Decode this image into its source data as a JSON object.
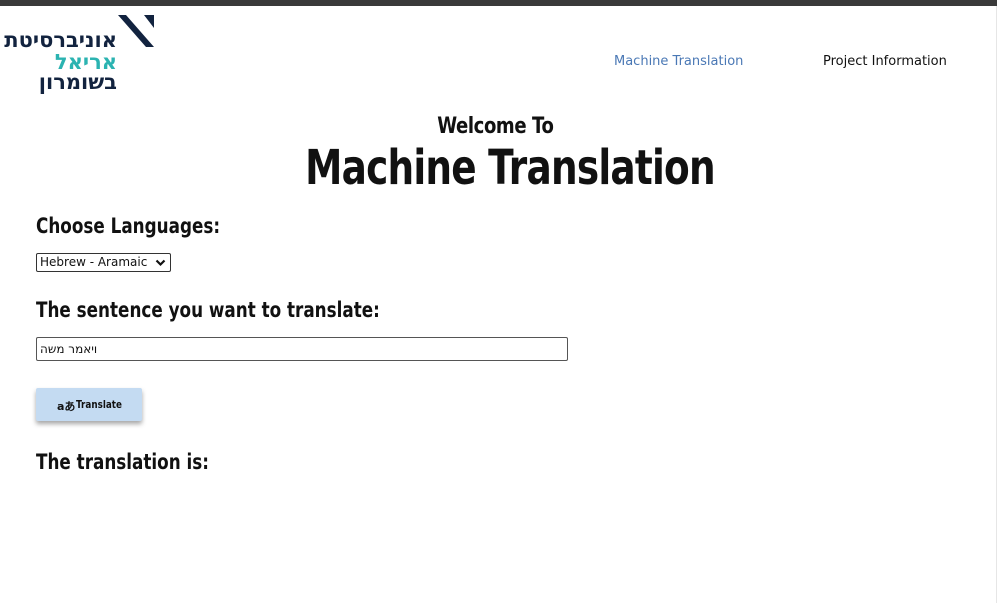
{
  "logo": {
    "line1": "אוניברסיטת",
    "line2": "אריאל",
    "line3": "בשומרון",
    "colors": {
      "navy": "#12233f",
      "teal": "#2bb3b1"
    }
  },
  "nav": {
    "machine_translation": "Machine Translation",
    "project_information": "Project Information"
  },
  "hero": {
    "welcome": "Welcome To",
    "title": "Machine Translation"
  },
  "form": {
    "choose_languages_label": "Choose Languages:",
    "language_selected": "Hebrew - Aramaic",
    "sentence_label": "The sentence you want to translate:",
    "sentence_value": "ויאמר משה",
    "translate_button": "Translate",
    "translate_icon": "translate-icon",
    "result_label": "The translation is:"
  },
  "colors": {
    "nav_active": "#4a78b5",
    "button_bg": "#c4dbf2",
    "topbar": "#3a3a3a"
  }
}
